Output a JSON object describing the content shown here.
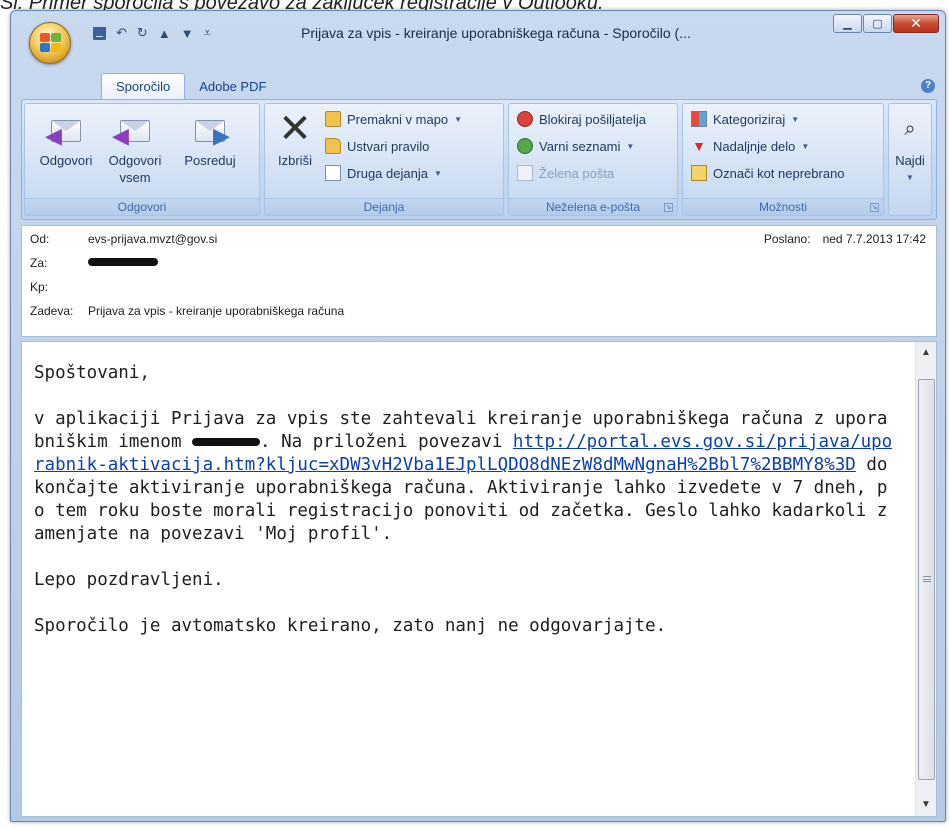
{
  "caption": "Sl. Primer sporočila s povezavo za zaključek registracije v Outlooku.",
  "window": {
    "title": "Prijava za vpis - kreiranje uporabniškega računa - Sporočilo (...",
    "tabs": [
      "Sporočilo",
      "Adobe PDF"
    ]
  },
  "ribbon": {
    "odgovori": {
      "label": "Odgovori",
      "buttons": [
        "Odgovori",
        "Odgovori vsem",
        "Posreduj"
      ]
    },
    "dejanja": {
      "label": "Dejanja",
      "delete": "Izbriši",
      "items": [
        "Premakni v mapo",
        "Ustvari pravilo",
        "Druga dejanja"
      ]
    },
    "nezelena": {
      "label": "Neželena e-pošta",
      "items": [
        "Blokiraj pošiljatelja",
        "Varni seznami",
        "Želena pošta"
      ]
    },
    "moznosti": {
      "label": "Možnosti",
      "items": [
        "Kategoriziraj",
        "Nadaljnje delo",
        "Označi kot neprebrano"
      ]
    },
    "find": "Najdi"
  },
  "header": {
    "from_label": "Od:",
    "from": "evs-prijava.mvzt@gov.si",
    "to_label": "Za:",
    "cc_label": "Kp:",
    "subject_label": "Zadeva:",
    "subject": "Prijava za vpis - kreiranje uporabniškega računa",
    "sent_label": "Poslano:",
    "sent": "ned 7.7.2013 17:42"
  },
  "body": {
    "greeting": "Spoštovani,",
    "p1_a": "v aplikaciji Prijava za vpis ste zahtevali kreiranje uporabniškega računa z uporabniškim imenom ",
    "p1_b": ". Na priloženi povezavi ",
    "link": "http://portal.evs.gov.si/prijava/uporabnik-aktivacija.htm?kljuc=xDW3vH2Vba1EJplLQDO8dNEzW8dMwNgnaH%2Bbl7%2BBMY8%3D",
    "p1_c": " dokončajte aktiviranje uporabniškega računa. Aktiviranje lahko izvedete v 7 dneh, po tem roku boste morali registracijo ponoviti od začetka. Geslo lahko kadarkoli zamenjate na povezavi 'Moj profil'.",
    "closing": "Lepo pozdravljeni.",
    "auto_note": "Sporočilo je avtomatsko kreirano, zato nanj ne odgovarjajte."
  },
  "colors": {
    "ribbon_bg": "#c5d8f1",
    "link": "#0b3fae",
    "close_button": "#c74b32"
  }
}
